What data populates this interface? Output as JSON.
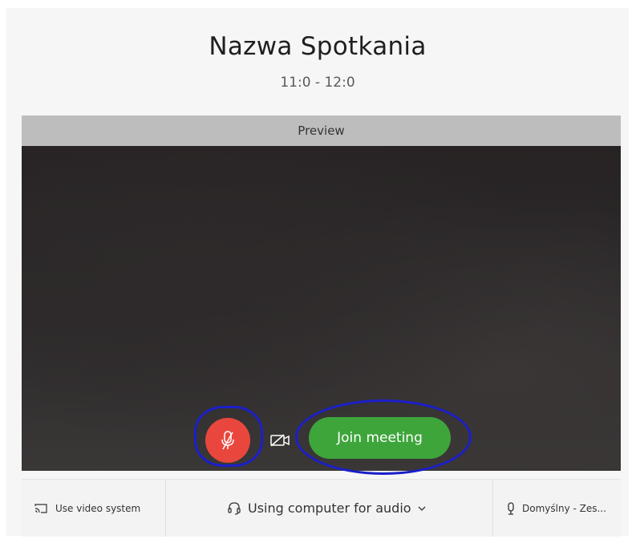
{
  "meeting": {
    "title": "Nazwa Spotkania",
    "time": "11:0 - 12:0"
  },
  "preview": {
    "label": "Preview"
  },
  "controls": {
    "mute_icon": "microphone-muted-icon",
    "camera_icon": "video-off-icon",
    "join_label": "Join meeting",
    "mute_color": "#e9473e",
    "join_color": "#3ea53b",
    "annotation_color": "#1b1fc9"
  },
  "footer": {
    "video_system_label": "Use video system",
    "video_system_icon": "cast-icon",
    "audio_label": "Using computer for audio",
    "audio_icon": "headset-icon",
    "audio_chevron_icon": "chevron-down-icon",
    "mic_label": "Domyślny - Zes...",
    "mic_icon": "microphone-icon"
  }
}
